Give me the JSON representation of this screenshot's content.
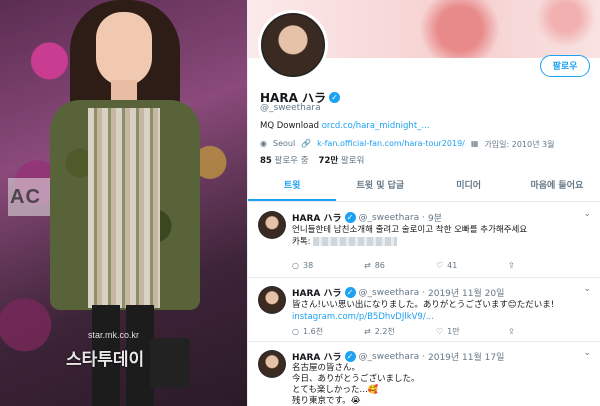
{
  "photo": {
    "backdrop_text": "AC",
    "watermark_small": "star.mk.co.kr",
    "watermark_big": "스타투데이"
  },
  "profile": {
    "follow_button": "팔로우",
    "display_name": "HARA ハラ",
    "handle": "@_sweethara",
    "bio_prefix": "MQ Download ",
    "bio_link": "orcd.co/hara_midnight_...",
    "location": "Seoul",
    "website": "k-fan.official-fan.com/hara-tour2019/",
    "joined": "가입일: 2010년 3월",
    "following_count": "85",
    "following_label": "팔로우 중",
    "followers_count": "72만",
    "followers_label": "팔로워"
  },
  "tabs": [
    "트윗",
    "트윗 및 답글",
    "미디어",
    "마음에 들어요"
  ],
  "tweets": [
    {
      "name": "HARA ハラ",
      "handle": "@_sweethara",
      "time": "9분",
      "text": "언니들한테 남친소개해 줄려고 술로이고 착한 오빠를 추가해주세요\n카톡:",
      "replies": "38",
      "retweets": "86",
      "likes": "41"
    },
    {
      "name": "HARA ハラ",
      "handle": "@_sweethara",
      "time": "2019년 11월 20일",
      "text": "皆さん!いい思い出になりました。ありがとうございます😊ただいま!",
      "link": "instagram.com/p/B5DhvDJlkV9/...",
      "replies": "1.6천",
      "retweets": "2.2천",
      "likes": "1만"
    },
    {
      "name": "HARA ハラ",
      "handle": "@_sweethara",
      "time": "2019년 11월 17일",
      "text": "名古屋の皆さん。\n今日、ありがとうございました。\nとても楽しかった…🥰\n残り東京です。😭"
    }
  ],
  "colors": {
    "accent": "#1da1f2",
    "text": "#14171a",
    "muted": "#657786"
  }
}
